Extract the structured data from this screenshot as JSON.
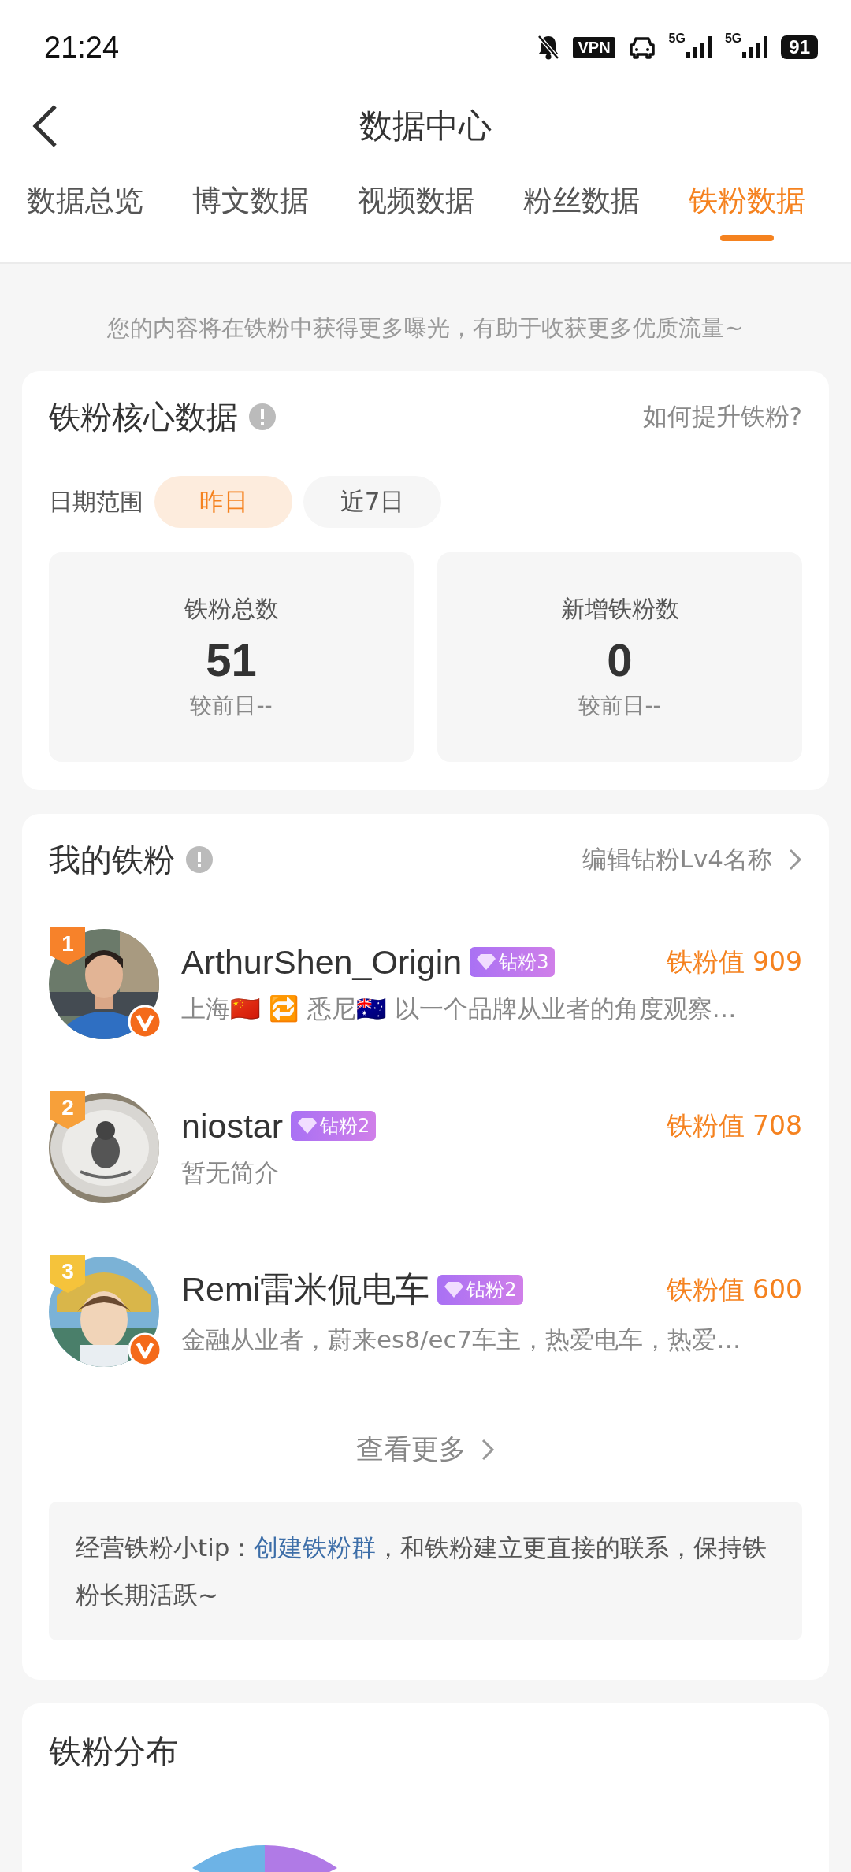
{
  "status_bar": {
    "time": "21:24",
    "vpn": "VPN",
    "network_1": "5G",
    "network_2": "5G",
    "battery": "91"
  },
  "header": {
    "title": "数据中心"
  },
  "tabs": [
    {
      "label": "数据总览",
      "selected": false
    },
    {
      "label": "博文数据",
      "selected": false
    },
    {
      "label": "视频数据",
      "selected": false
    },
    {
      "label": "粉丝数据",
      "selected": false
    },
    {
      "label": "铁粉数据",
      "selected": true
    }
  ],
  "notice": "您的内容将在铁粉中获得更多曝光，有助于收获更多优质流量~",
  "core_card": {
    "title": "铁粉核心数据",
    "link": "如何提升铁粉?",
    "date_label": "日期范围",
    "date_options": [
      {
        "label": "昨日",
        "selected": true
      },
      {
        "label": "近7日",
        "selected": false
      }
    ],
    "stats": [
      {
        "label": "铁粉总数",
        "value": "51",
        "compare": "较前日--"
      },
      {
        "label": "新增铁粉数",
        "value": "0",
        "compare": "较前日--"
      }
    ]
  },
  "fans_card": {
    "title": "我的铁粉",
    "link": "编辑钻粉Lv4名称",
    "fans": [
      {
        "rank": "1",
        "color": "#f7822a",
        "name": "ArthurShen_Origin",
        "badge": "钻粉3",
        "value": "铁粉值 909",
        "bio": "上海🇨🇳 🔁 悉尼🇦🇺 以一个品牌从业者的角度观察…",
        "verified": true
      },
      {
        "rank": "2",
        "color": "#f7a03a",
        "name": "niostar",
        "badge": "钻粉2",
        "value": "铁粉值 708",
        "bio": "暂无简介",
        "verified": false
      },
      {
        "rank": "3",
        "color": "#f5c33b",
        "name": "Remi雷米侃电车",
        "badge": "钻粉2",
        "value": "铁粉值 600",
        "bio": "金融从业者，蔚来es8/ec7车主，热爱电车，热爱…",
        "verified": true
      }
    ],
    "more": "查看更多",
    "tip_prefix": "经营铁粉小tip：",
    "tip_link": "创建铁粉群",
    "tip_suffix": "，和铁粉建立更直接的联系，保持铁粉长期活跃~"
  },
  "distribution_card": {
    "title": "铁粉分布"
  }
}
